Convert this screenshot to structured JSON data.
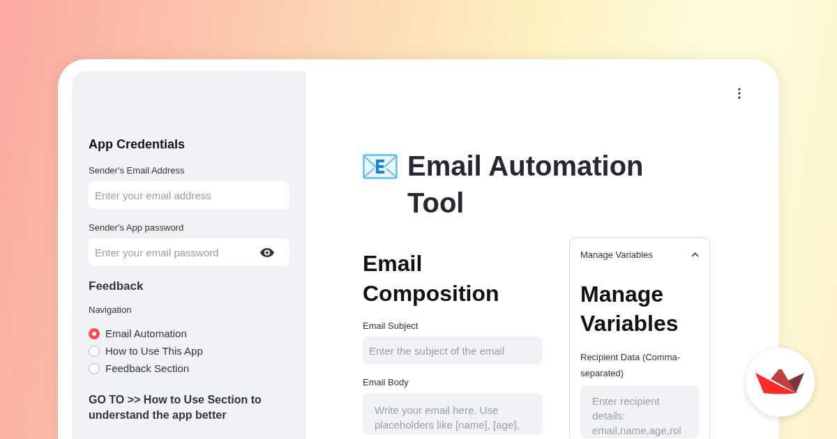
{
  "sidebar": {
    "credentials": {
      "heading": "App Credentials",
      "fields": [
        {
          "label": "Sender's Email Address",
          "placeholder": "Enter your email address",
          "kind": "text"
        },
        {
          "label": "Sender's App password",
          "placeholder": "Enter your email password",
          "kind": "password"
        }
      ]
    },
    "feedback": {
      "heading": "Feedback"
    },
    "navigation": {
      "label": "Navigation",
      "options": [
        {
          "label": "Email Automation",
          "selected": true
        },
        {
          "label": "How to Use This App",
          "selected": false
        },
        {
          "label": "Feedback Section",
          "selected": false
        }
      ]
    },
    "note": "GO TO >> How to Use Section to understand the app better"
  },
  "main": {
    "title": "Email Automation Tool",
    "composition": {
      "heading": "Email Composition",
      "fields": [
        {
          "label": "Email Subject",
          "placeholder": "Enter the subject of the email",
          "kind": "line"
        },
        {
          "label": "Email Body",
          "placeholder": "Write your email here. Use placeholders like [name], [age],",
          "kind": "area"
        }
      ]
    },
    "variables": {
      "summary": "Manage Variables",
      "expanded": true,
      "heading": "Manage Variables",
      "fields": [
        {
          "label": "Recipient Data (Comma-separated)",
          "placeholder": "Enter recipient details: email,name,age,rol",
          "kind": "area"
        }
      ]
    }
  }
}
